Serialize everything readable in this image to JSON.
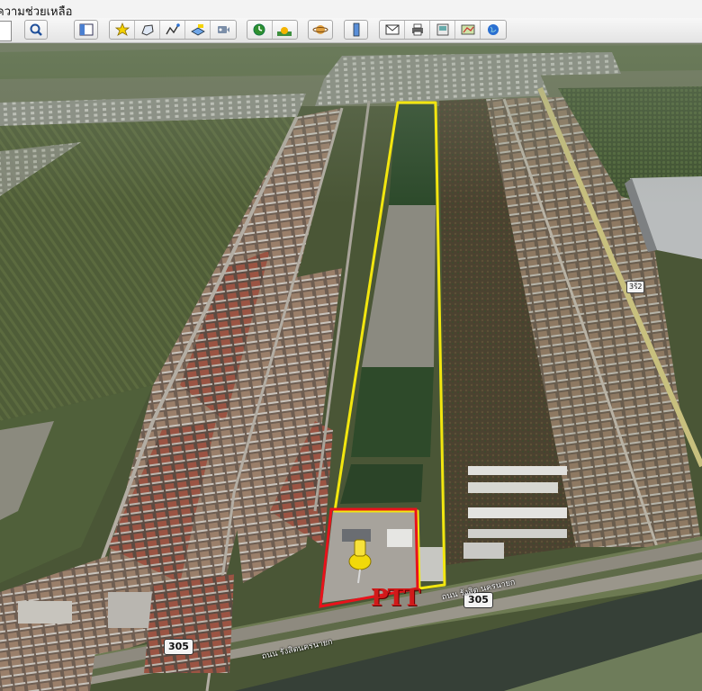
{
  "menubar": {
    "help_label": "ความช่วยเหลือ"
  },
  "toolbar": {
    "buttons": [
      "search-icon",
      "sidebar-icon",
      "placemark-icon",
      "polygon-icon",
      "path-icon",
      "overlay-icon",
      "tour-icon",
      "history-icon",
      "sunlight-icon",
      "planet-icon",
      "ruler-icon",
      "email-icon",
      "print-icon",
      "save-image-icon",
      "map-view-icon",
      "earth-icon"
    ]
  },
  "map": {
    "roads": {
      "highway_shield": "305",
      "highway_shield_lower": "305",
      "side_shield": "3ร้2",
      "highway_label_upper": "ถนน รังสิต นครนายก",
      "highway_label_lower": "ถนน รังสิตนครนายก"
    },
    "brand_label": "PTT",
    "colors": {
      "site_outline": "#f2e60f",
      "station_outline": "#e8121b",
      "brand": "#d11a1a"
    }
  }
}
